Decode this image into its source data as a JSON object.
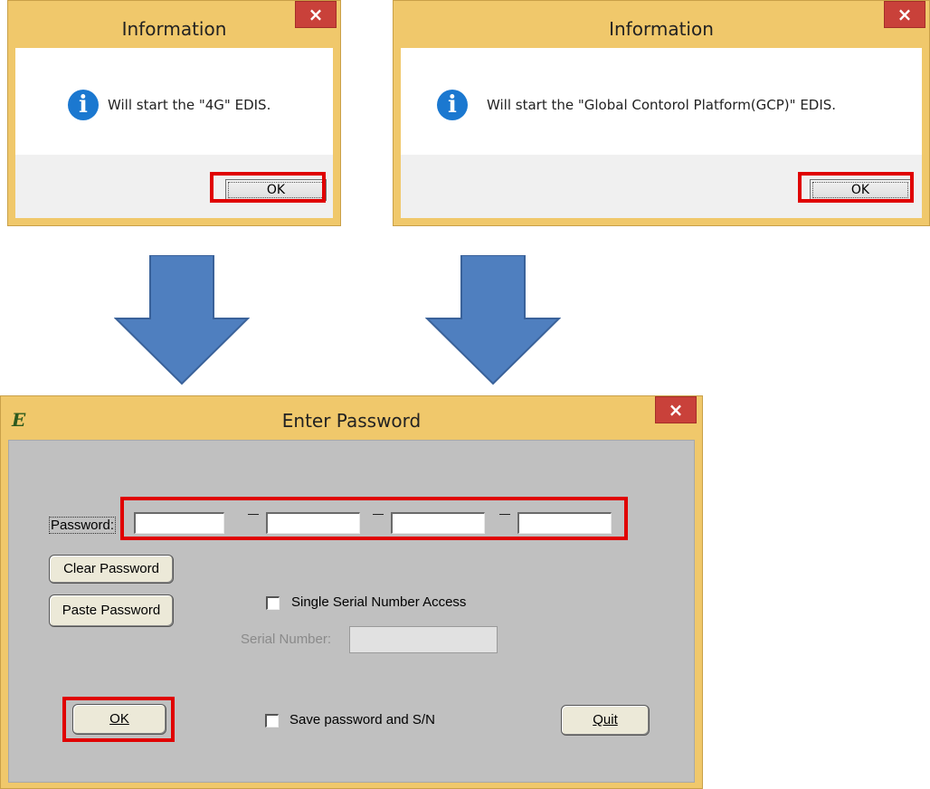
{
  "dialog_4g": {
    "title": "Information",
    "close": "×",
    "message": "Will start the \"4G\" EDIS.",
    "ok_label": "OK"
  },
  "dialog_gcp": {
    "title": "Information",
    "close": "×",
    "message": "Will start the \"Global Contorol Platform(GCP)\" EDIS.",
    "ok_label": "OK"
  },
  "password_dialog": {
    "title": "Enter Password",
    "logo_text": "E",
    "close": "×",
    "password_label": "Password:",
    "password_fields": [
      "",
      "",
      "",
      ""
    ],
    "clear_button": "Clear Password",
    "paste_button": "Paste Password",
    "single_serial_label": "Single Serial Number Access",
    "single_serial_checked": false,
    "serial_number_label": "Serial Number:",
    "serial_number_value": "",
    "ok_button": "OK",
    "save_label": "Save password and S/N",
    "save_checked": false,
    "quit_button": "Quit"
  },
  "colors": {
    "window_frame": "#f0c86b",
    "close_button": "#c9413a",
    "highlight": "#e00000",
    "arrow": "#4f7fbf",
    "dialog_client": "#c0c0c0"
  },
  "icons": [
    "info-icon",
    "close-icon",
    "down-arrow-icon",
    "edis-logo-icon",
    "checkbox-icon"
  ]
}
